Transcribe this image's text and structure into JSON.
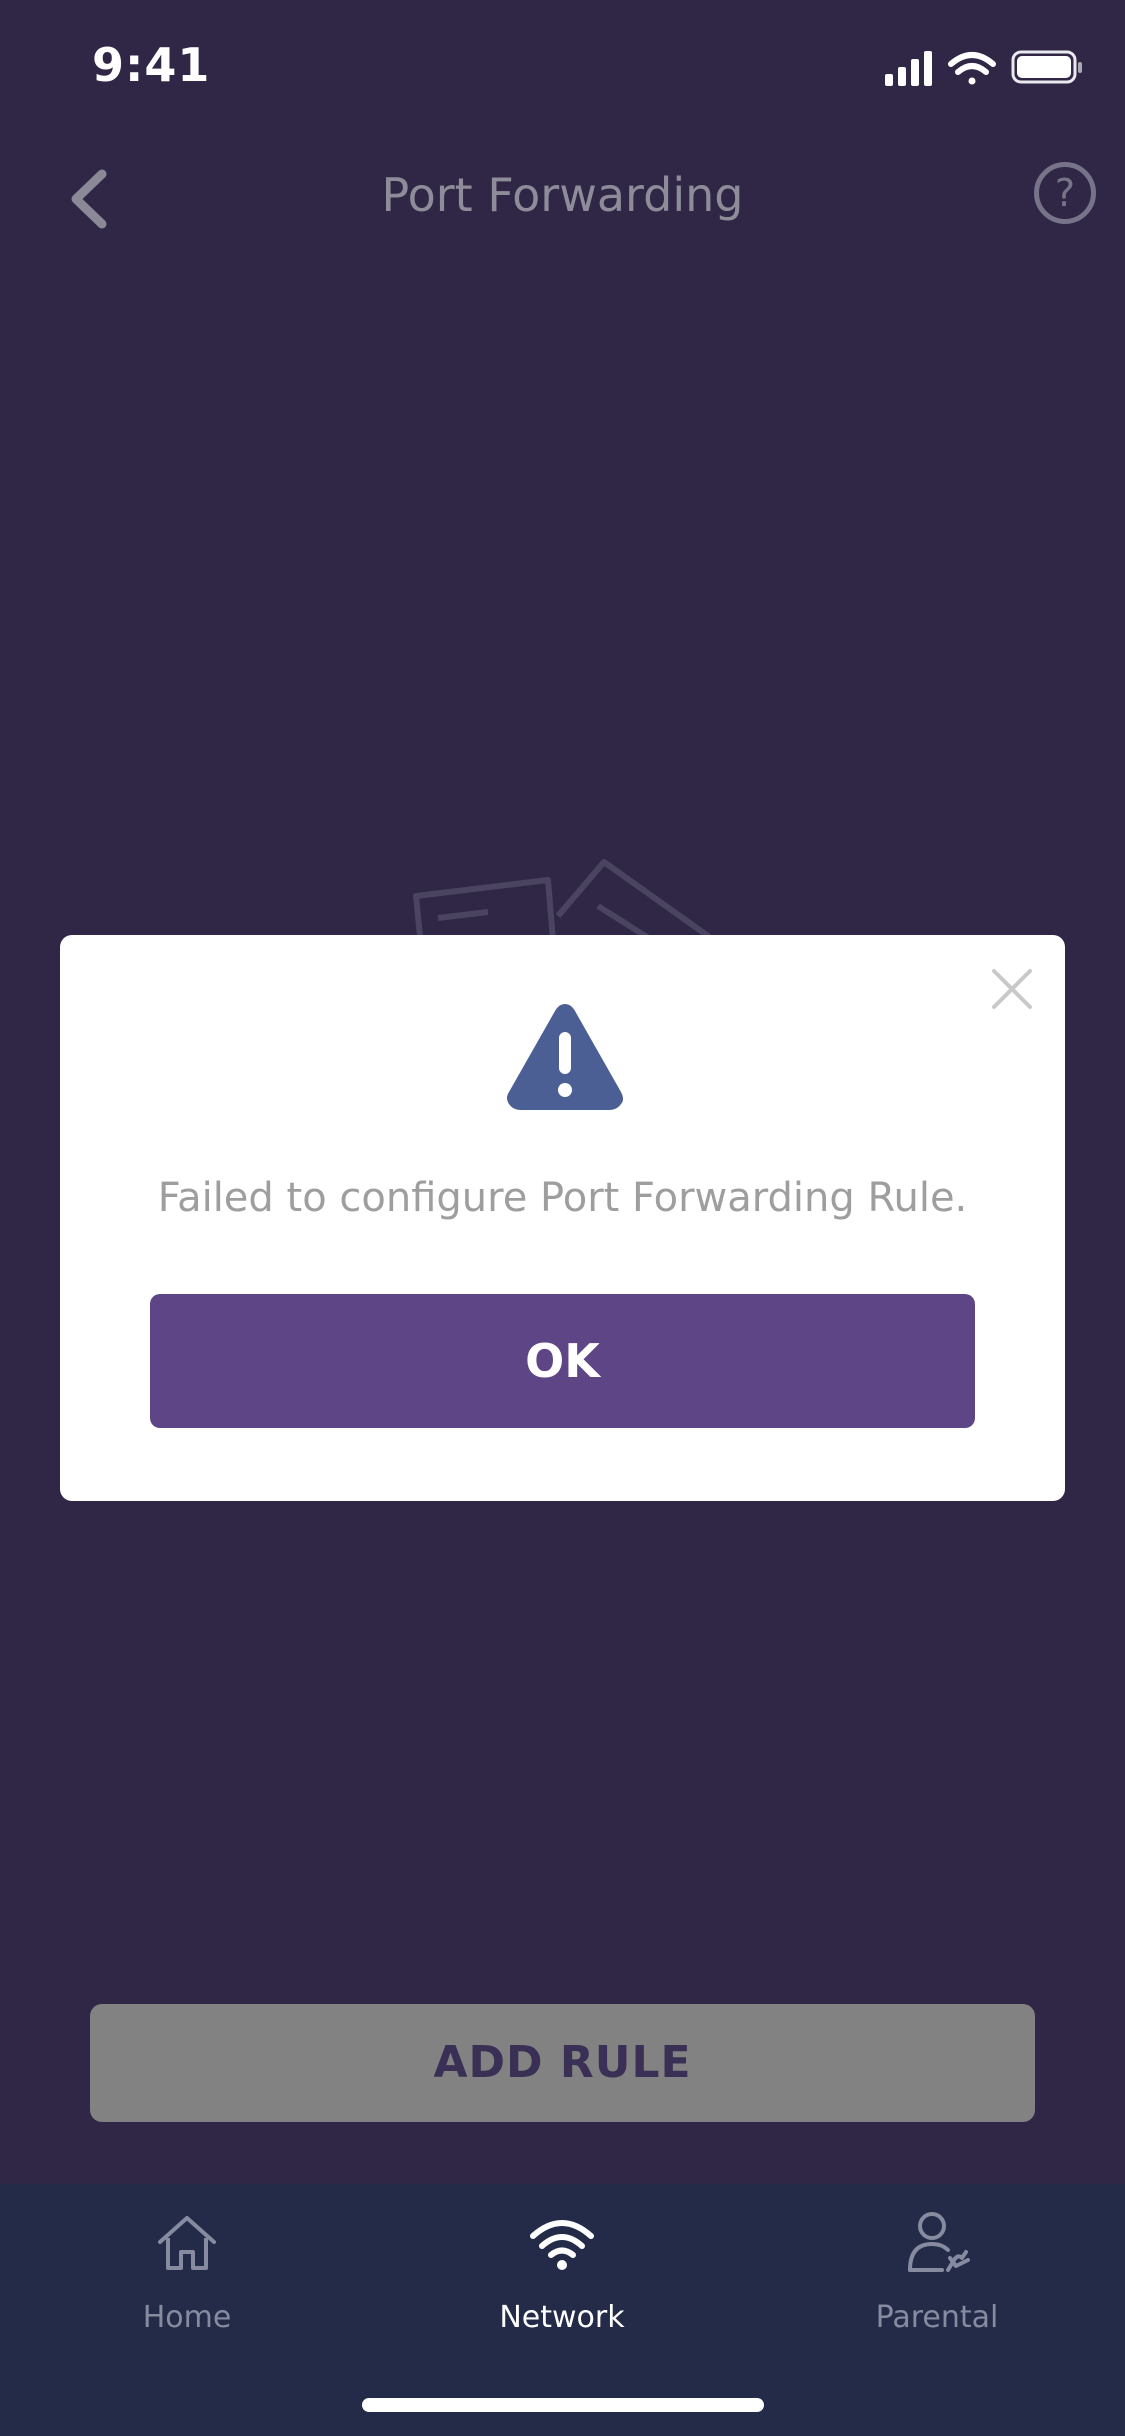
{
  "status_bar": {
    "time": "9:41",
    "icons": [
      "cellular-signal-icon",
      "wifi-icon",
      "battery-icon"
    ]
  },
  "header": {
    "title": "Port Forwarding",
    "back_icon": "chevron-left-icon",
    "help_label": "?"
  },
  "main": {
    "add_rule_label": "ADD RULE",
    "illustration_icon": "empty-documents-illustration"
  },
  "dialog": {
    "icon": "warning-triangle-icon",
    "message": "Failed to configure Port Forwarding Rule.",
    "ok_label": "OK",
    "close_icon": "close-icon"
  },
  "tab_bar": {
    "items": [
      {
        "label": "Home",
        "icon": "home-icon",
        "active": false
      },
      {
        "label": "Network",
        "icon": "wifi-icon",
        "active": true
      },
      {
        "label": "Parental",
        "icon": "parental-icon",
        "active": false
      }
    ]
  },
  "colors": {
    "background": "#2f2745",
    "tab_bar": "#232b48",
    "accent": "#5e4686",
    "warning_icon": "#4c5f95",
    "disabled_button": "#828282"
  }
}
